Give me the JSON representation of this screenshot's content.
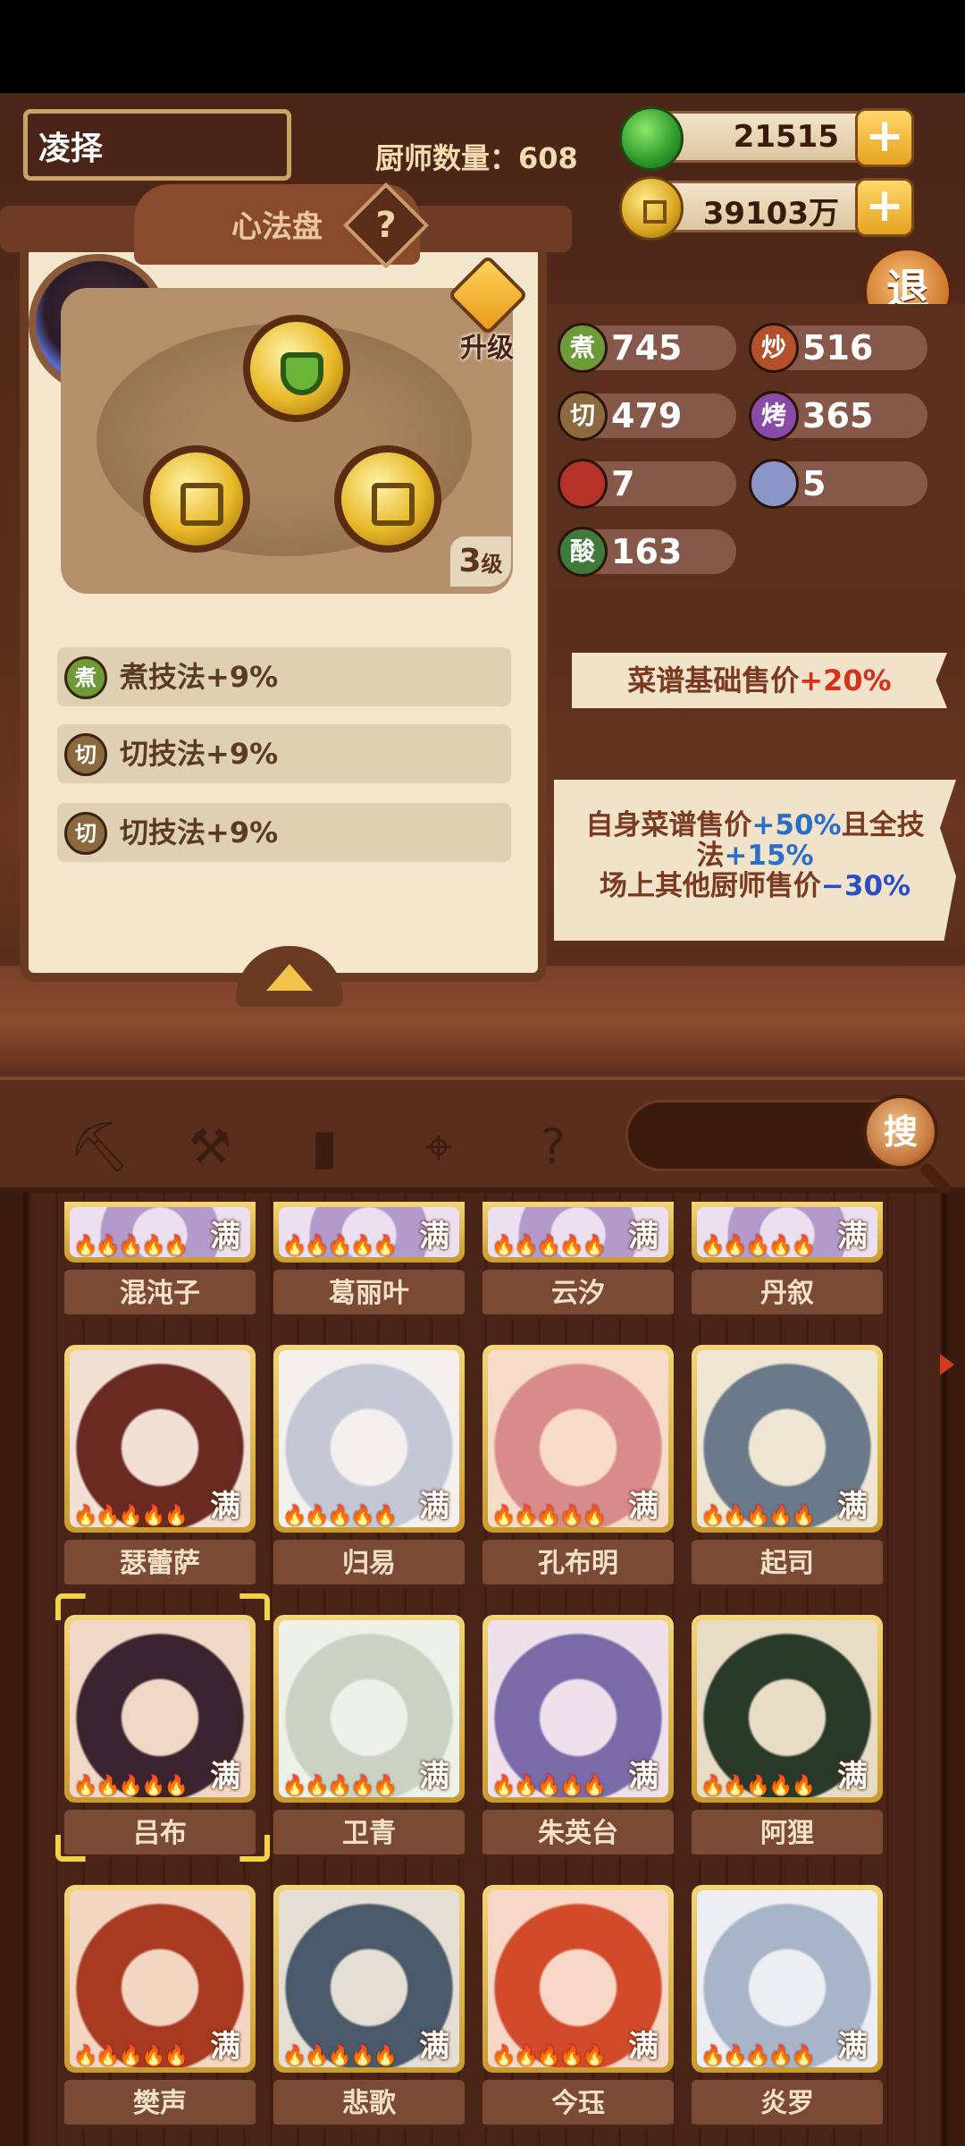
{
  "player": {
    "name": "凌择",
    "chef_count_label": "厨师数量：608"
  },
  "currency": {
    "jade": "21515",
    "coins": "39103万",
    "plus": "+"
  },
  "retreat_label": "退",
  "heart_method": {
    "title": "心法盘",
    "help": "?",
    "upgrade_label": "升级",
    "level_number": "3",
    "level_suffix": "级",
    "skills": [
      {
        "icon_label": "煮",
        "text": "煮技法+9%"
      },
      {
        "icon_label": "切",
        "text": "切技法+9%"
      },
      {
        "icon_label": "切",
        "text": "切技法+9%"
      }
    ]
  },
  "stats": [
    {
      "icon_label": "煮",
      "value": "745"
    },
    {
      "icon_label": "炒",
      "value": "516"
    },
    {
      "icon_label": "切",
      "value": "479"
    },
    {
      "icon_label": "烤",
      "value": "365"
    },
    {
      "icon_label": "",
      "value": "7"
    },
    {
      "icon_label": "",
      "value": "5"
    },
    {
      "icon_label": "酸",
      "value": "163"
    }
  ],
  "bonuses": {
    "b1_text": "菜谱基础售价",
    "b1_value": "+20%",
    "b2_line1a": "自身菜谱售价",
    "b2_line1b": "+50%",
    "b2_line1c": "且全技",
    "b2_line2a": "法",
    "b2_line2b": "+15%",
    "b2_line3a": "场上其他厨师售价",
    "b2_line3b": "−30%"
  },
  "search_label": "搜",
  "full_label": "满",
  "flames": "🔥🔥🔥🔥🔥",
  "chefs_top": [
    "混沌子",
    "葛丽叶",
    "云汐",
    "丹叙"
  ],
  "chefs": [
    "瑟蕾萨",
    "归易",
    "孔布明",
    "起司",
    "吕布",
    "卫青",
    "朱英台",
    "阿狸",
    "樊声",
    "悲歌",
    "今珏",
    "炎罗"
  ]
}
